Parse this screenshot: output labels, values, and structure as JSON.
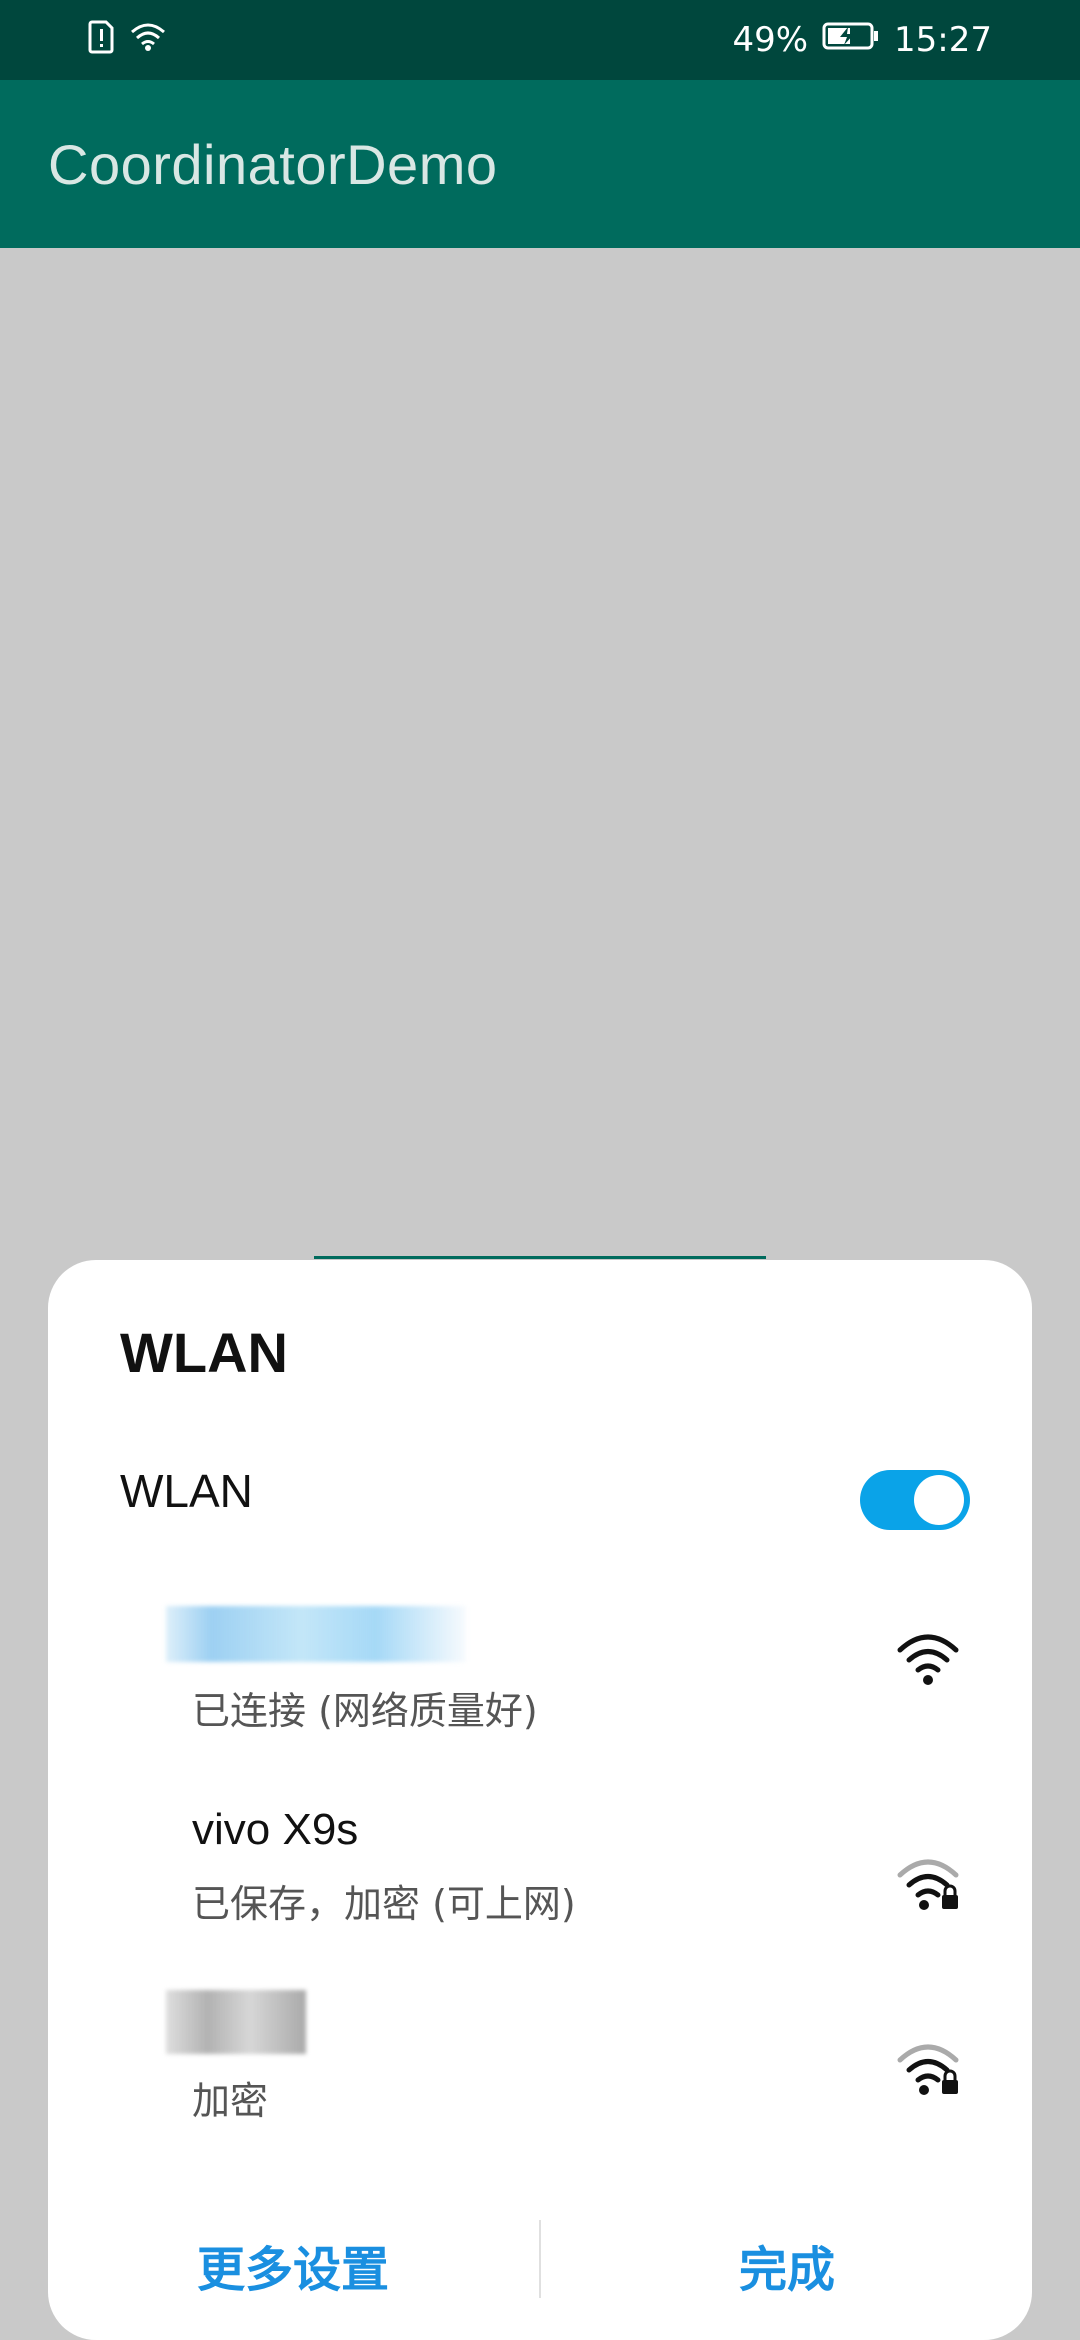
{
  "status_bar": {
    "battery_percent": "49%",
    "time": "15:27",
    "icons": [
      "sim-alert-icon",
      "wifi-icon",
      "battery-charging-icon"
    ]
  },
  "app_bar": {
    "title": "CoordinatorDemo"
  },
  "dialog": {
    "title": "WLAN",
    "wlan_toggle_label": "WLAN",
    "wlan_enabled": true,
    "networks": [
      {
        "name": "",
        "status": "已连接 (网络质量好)",
        "secured": false
      },
      {
        "name": "vivo X9s",
        "status": "已保存，加密 (可上网)",
        "secured": true
      },
      {
        "name": "",
        "status": "加密",
        "secured": true
      }
    ],
    "buttons": {
      "more_settings": "更多设置",
      "done": "完成"
    }
  },
  "colors": {
    "status_bar": "#00473d",
    "app_bar": "#006b5d",
    "accent": "#1a8fe0",
    "toggle_on": "#0aa3e8",
    "dim_background": "#c9c9c9"
  }
}
